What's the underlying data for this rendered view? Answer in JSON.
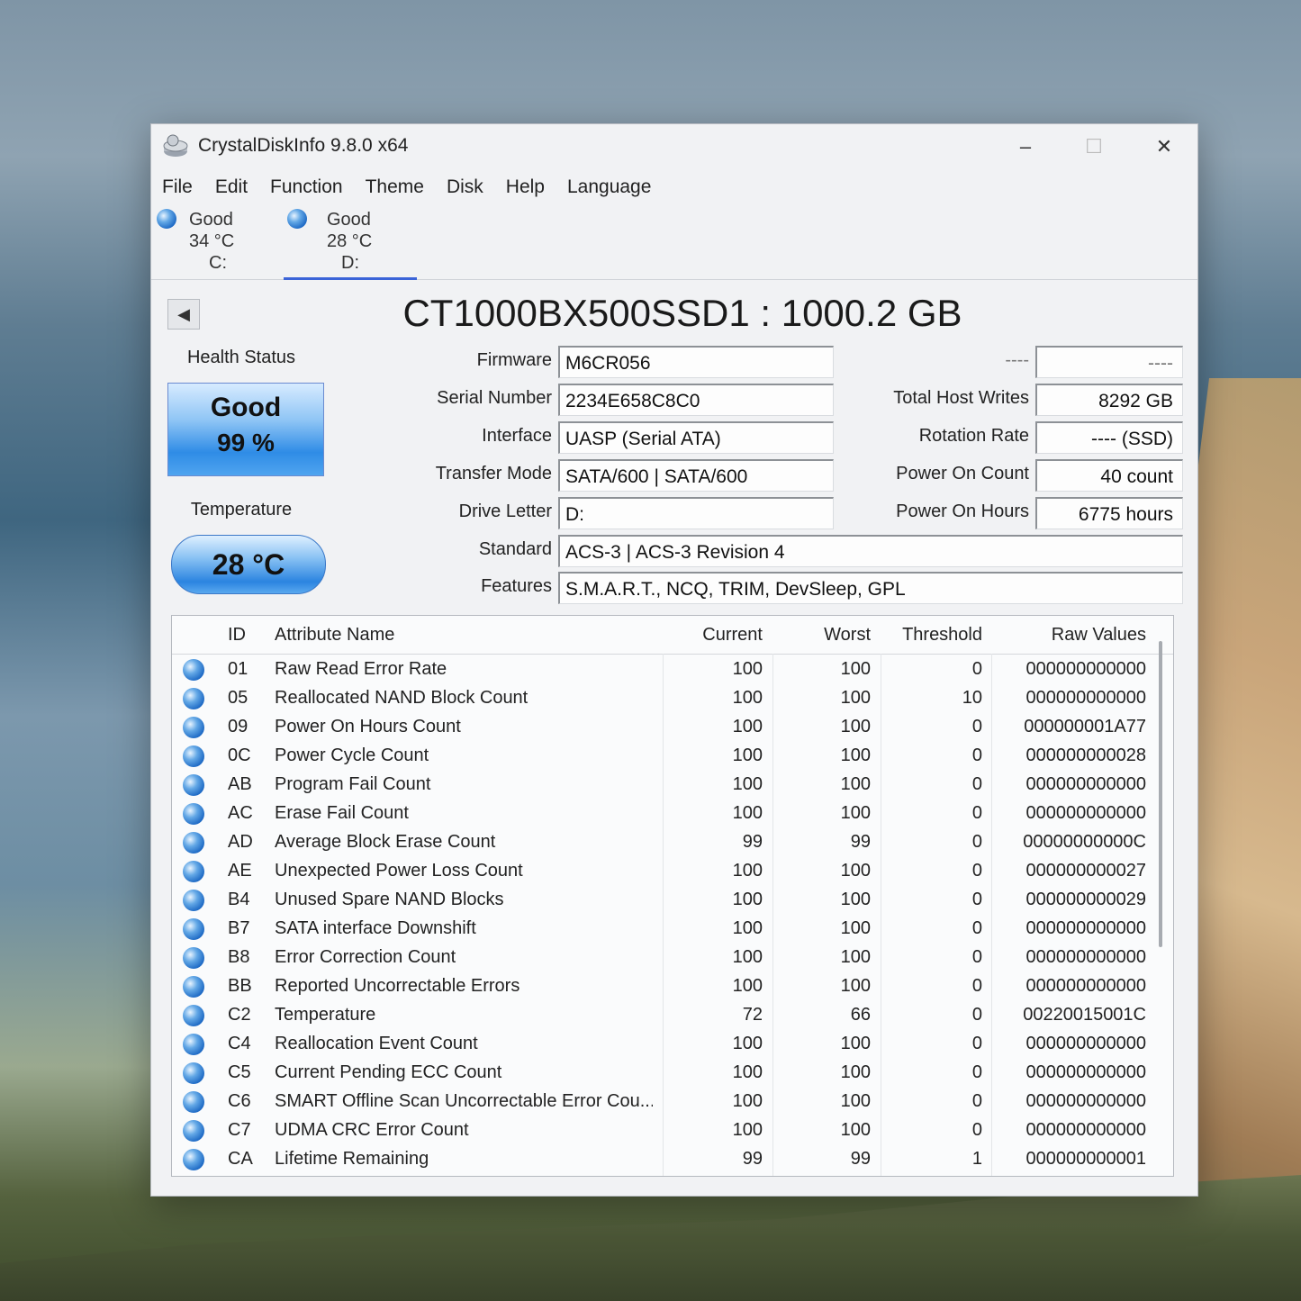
{
  "window": {
    "title": "CrystalDiskInfo 9.8.0 x64"
  },
  "window_controls": {
    "minimize": "–",
    "maximize": "☐",
    "close": "✕"
  },
  "menu": [
    "File",
    "Edit",
    "Function",
    "Theme",
    "Disk",
    "Help",
    "Language"
  ],
  "disks": [
    {
      "status": "Good",
      "temp": "34 °C",
      "letter": "C:"
    },
    {
      "status": "Good",
      "temp": "28 °C",
      "letter": "D:"
    }
  ],
  "drive": {
    "title": "CT1000BX500SSD1 : 1000.2 GB"
  },
  "health": {
    "label": "Health Status",
    "status": "Good",
    "percent": "99 %"
  },
  "temperature": {
    "label": "Temperature",
    "value": "28 °C"
  },
  "info": {
    "firmware_label": "Firmware",
    "firmware": "M6CR056",
    "serial_label": "Serial Number",
    "serial": "2234E658C8C0",
    "interface_label": "Interface",
    "interface": "UASP (Serial ATA)",
    "transfer_label": "Transfer Mode",
    "transfer": "SATA/600 | SATA/600",
    "drive_letter_label": "Drive Letter",
    "drive_letter": "D:",
    "standard_label": "Standard",
    "standard": "ACS-3 | ACS-3 Revision 4",
    "features_label": "Features",
    "features": "S.M.A.R.T., NCQ, TRIM, DevSleep, GPL",
    "blank_label": "----",
    "blank_value": "----",
    "host_writes_label": "Total Host Writes",
    "host_writes": "8292 GB",
    "rotation_label": "Rotation Rate",
    "rotation": "---- (SSD)",
    "power_count_label": "Power On Count",
    "power_count": "40 count",
    "power_hours_label": "Power On Hours",
    "power_hours": "6775 hours"
  },
  "table": {
    "headers": {
      "id": "ID",
      "name": "Attribute Name",
      "current": "Current",
      "worst": "Worst",
      "threshold": "Threshold",
      "raw": "Raw Values"
    },
    "rows": [
      {
        "id": "01",
        "name": "Raw Read Error Rate",
        "current": "100",
        "worst": "100",
        "threshold": "0",
        "raw": "000000000000"
      },
      {
        "id": "05",
        "name": "Reallocated NAND Block Count",
        "current": "100",
        "worst": "100",
        "threshold": "10",
        "raw": "000000000000"
      },
      {
        "id": "09",
        "name": "Power On Hours Count",
        "current": "100",
        "worst": "100",
        "threshold": "0",
        "raw": "000000001A77"
      },
      {
        "id": "0C",
        "name": "Power Cycle Count",
        "current": "100",
        "worst": "100",
        "threshold": "0",
        "raw": "000000000028"
      },
      {
        "id": "AB",
        "name": "Program Fail Count",
        "current": "100",
        "worst": "100",
        "threshold": "0",
        "raw": "000000000000"
      },
      {
        "id": "AC",
        "name": "Erase Fail Count",
        "current": "100",
        "worst": "100",
        "threshold": "0",
        "raw": "000000000000"
      },
      {
        "id": "AD",
        "name": "Average Block Erase Count",
        "current": "99",
        "worst": "99",
        "threshold": "0",
        "raw": "00000000000C"
      },
      {
        "id": "AE",
        "name": "Unexpected Power Loss Count",
        "current": "100",
        "worst": "100",
        "threshold": "0",
        "raw": "000000000027"
      },
      {
        "id": "B4",
        "name": "Unused Spare NAND Blocks",
        "current": "100",
        "worst": "100",
        "threshold": "0",
        "raw": "000000000029"
      },
      {
        "id": "B7",
        "name": "SATA interface Downshift",
        "current": "100",
        "worst": "100",
        "threshold": "0",
        "raw": "000000000000"
      },
      {
        "id": "B8",
        "name": "Error Correction Count",
        "current": "100",
        "worst": "100",
        "threshold": "0",
        "raw": "000000000000"
      },
      {
        "id": "BB",
        "name": "Reported Uncorrectable Errors",
        "current": "100",
        "worst": "100",
        "threshold": "0",
        "raw": "000000000000"
      },
      {
        "id": "C2",
        "name": "Temperature",
        "current": "72",
        "worst": "66",
        "threshold": "0",
        "raw": "00220015001C"
      },
      {
        "id": "C4",
        "name": "Reallocation Event Count",
        "current": "100",
        "worst": "100",
        "threshold": "0",
        "raw": "000000000000"
      },
      {
        "id": "C5",
        "name": "Current Pending ECC Count",
        "current": "100",
        "worst": "100",
        "threshold": "0",
        "raw": "000000000000"
      },
      {
        "id": "C6",
        "name": "SMART Offline Scan Uncorrectable Error Cou...",
        "current": "100",
        "worst": "100",
        "threshold": "0",
        "raw": "000000000000"
      },
      {
        "id": "C7",
        "name": "UDMA CRC Error Count",
        "current": "100",
        "worst": "100",
        "threshold": "0",
        "raw": "000000000000"
      },
      {
        "id": "CA",
        "name": "Lifetime Remaining",
        "current": "99",
        "worst": "99",
        "threshold": "1",
        "raw": "000000000001"
      }
    ]
  }
}
